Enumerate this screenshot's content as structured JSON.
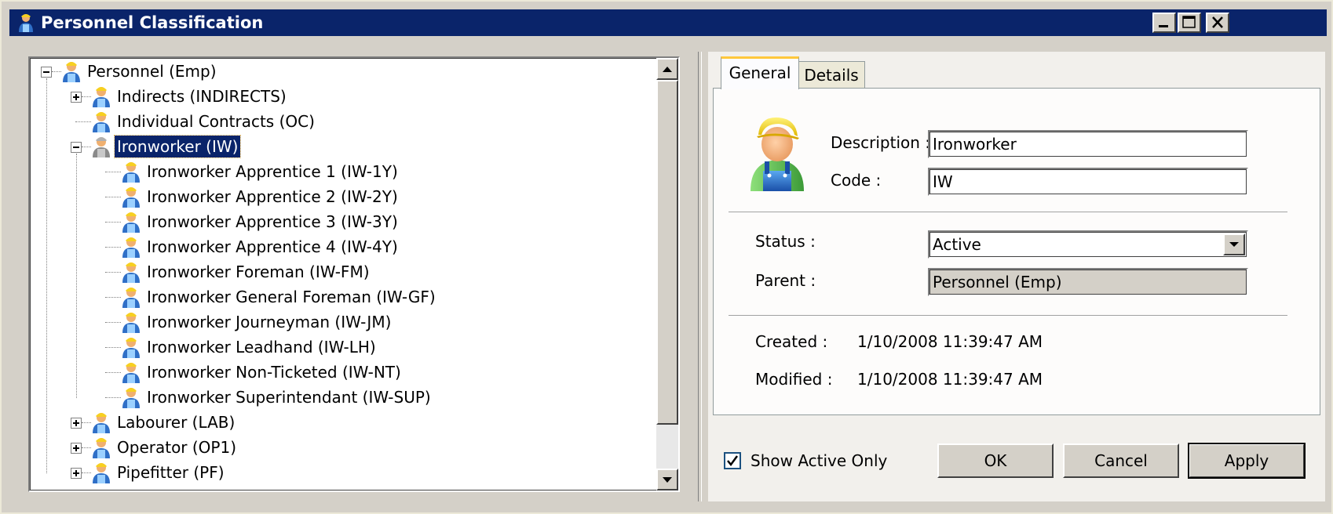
{
  "window": {
    "title": "Personnel Classification"
  },
  "tree": {
    "rows": [
      {
        "label": "Personnel (Emp)",
        "level": 0,
        "expander": "minus",
        "icon": "person-icon"
      },
      {
        "label": "Indirects (INDIRECTS)",
        "level": 1,
        "expander": "plus",
        "icon": "person-icon"
      },
      {
        "label": "Individual Contracts (OC)",
        "level": 1,
        "expander": "none",
        "icon": "person-icon"
      },
      {
        "label": "Ironworker (IW)",
        "level": 1,
        "expander": "minus",
        "icon": "person-gray-icon",
        "selected": true
      },
      {
        "label": "Ironworker Apprentice 1 (IW-1Y)",
        "level": 2,
        "expander": "none",
        "icon": "person-icon"
      },
      {
        "label": "Ironworker Apprentice 2 (IW-2Y)",
        "level": 2,
        "expander": "none",
        "icon": "person-icon"
      },
      {
        "label": "Ironworker Apprentice 3 (IW-3Y)",
        "level": 2,
        "expander": "none",
        "icon": "person-icon"
      },
      {
        "label": "Ironworker Apprentice 4 (IW-4Y)",
        "level": 2,
        "expander": "none",
        "icon": "person-icon"
      },
      {
        "label": "Ironworker Foreman (IW-FM)",
        "level": 2,
        "expander": "none",
        "icon": "person-icon"
      },
      {
        "label": "Ironworker General Foreman (IW-GF)",
        "level": 2,
        "expander": "none",
        "icon": "person-icon"
      },
      {
        "label": "Ironworker Journeyman (IW-JM)",
        "level": 2,
        "expander": "none",
        "icon": "person-icon"
      },
      {
        "label": "Ironworker Leadhand (IW-LH)",
        "level": 2,
        "expander": "none",
        "icon": "person-icon"
      },
      {
        "label": "Ironworker Non-Ticketed (IW-NT)",
        "level": 2,
        "expander": "none",
        "icon": "person-icon"
      },
      {
        "label": "Ironworker Superintendant (IW-SUP)",
        "level": 2,
        "expander": "none",
        "icon": "person-icon"
      },
      {
        "label": "Labourer (LAB)",
        "level": 1,
        "expander": "plus",
        "icon": "person-icon"
      },
      {
        "label": "Operator (OP1)",
        "level": 1,
        "expander": "plus",
        "icon": "person-icon"
      },
      {
        "label": "Pipefitter (PF)",
        "level": 1,
        "expander": "plus",
        "icon": "person-icon"
      }
    ]
  },
  "tabs": {
    "general": "General",
    "details": "Details"
  },
  "general": {
    "description_label": "Description :",
    "description_value": "Ironworker",
    "code_label": "Code :",
    "code_value": "IW",
    "status_label": "Status :",
    "status_value": "Active",
    "parent_label": "Parent :",
    "parent_value": "Personnel (Emp)",
    "created_label": "Created :",
    "created_value": "1/10/2008 11:39:47 AM",
    "modified_label": "Modified :",
    "modified_value": "1/10/2008 11:39:47 AM"
  },
  "footer": {
    "show_active_only": "Show Active Only",
    "show_active_checked": true,
    "ok": "OK",
    "cancel": "Cancel",
    "apply": "Apply"
  },
  "colors": {
    "titlebar": "#0a246a",
    "selection": "#0a246a",
    "tab_highlight": "#ffc83c"
  }
}
